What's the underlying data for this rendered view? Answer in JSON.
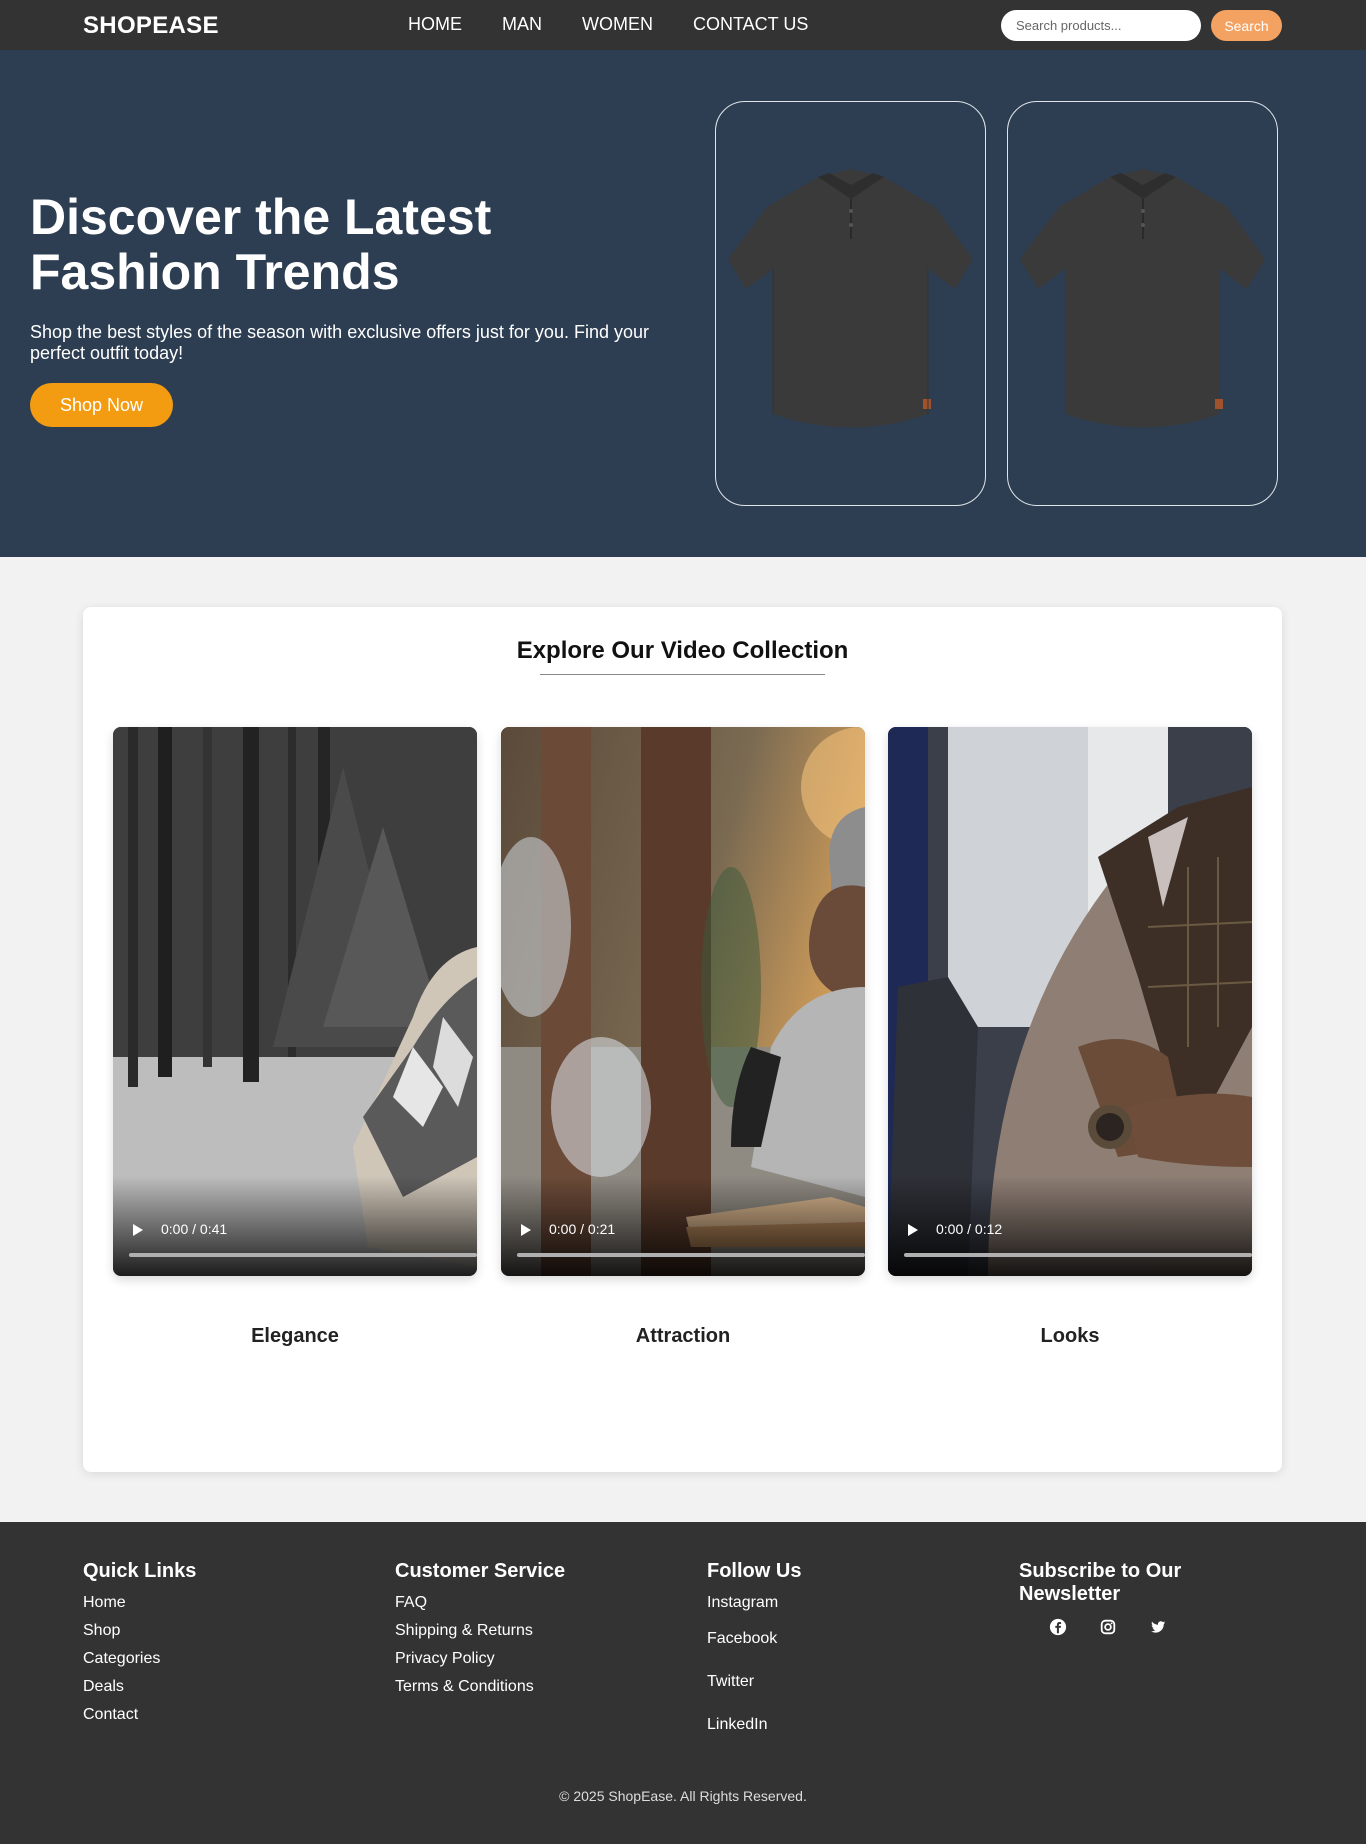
{
  "nav": {
    "brand": "SHOPEASE",
    "links": [
      "HOME",
      "MAN",
      "WOMEN",
      "CONTACT US"
    ],
    "search_placeholder": "Search products...",
    "search_button": "Search"
  },
  "hero": {
    "title": "Discover the Latest Fashion Trends",
    "subtitle": "Shop the best styles of the season with exclusive offers just for you. Find your perfect outfit today!",
    "cta": "Shop Now"
  },
  "videos": {
    "title": "Explore Our Video Collection",
    "items": [
      {
        "label": "Elegance",
        "time": "0:00 / 0:41"
      },
      {
        "label": "Attraction",
        "time": "0:00 / 0:21"
      },
      {
        "label": "Looks",
        "time": "0:00 / 0:12"
      }
    ]
  },
  "footer": {
    "quick_links": {
      "title": "Quick Links",
      "items": [
        "Home",
        "Shop",
        "Categories",
        "Deals",
        "Contact"
      ]
    },
    "customer_service": {
      "title": "Customer Service",
      "items": [
        "FAQ",
        "Shipping & Returns",
        "Privacy Policy",
        "Terms & Conditions"
      ]
    },
    "follow_us": {
      "title": "Follow Us",
      "items": [
        "Instagram",
        "Facebook",
        "Twitter",
        "LinkedIn"
      ]
    },
    "newsletter": {
      "title": "Subscribe to Our Newsletter",
      "icons": [
        "facebook-icon",
        "instagram-icon",
        "twitter-icon"
      ]
    },
    "copyright": "© 2025 ShopEase. All Rights Reserved."
  },
  "colors": {
    "nav_bg": "#333333",
    "hero_bg": "#2d3e52",
    "accent_orange": "#f39c12",
    "search_button": "#f4a261",
    "footer_bg": "#333333"
  }
}
